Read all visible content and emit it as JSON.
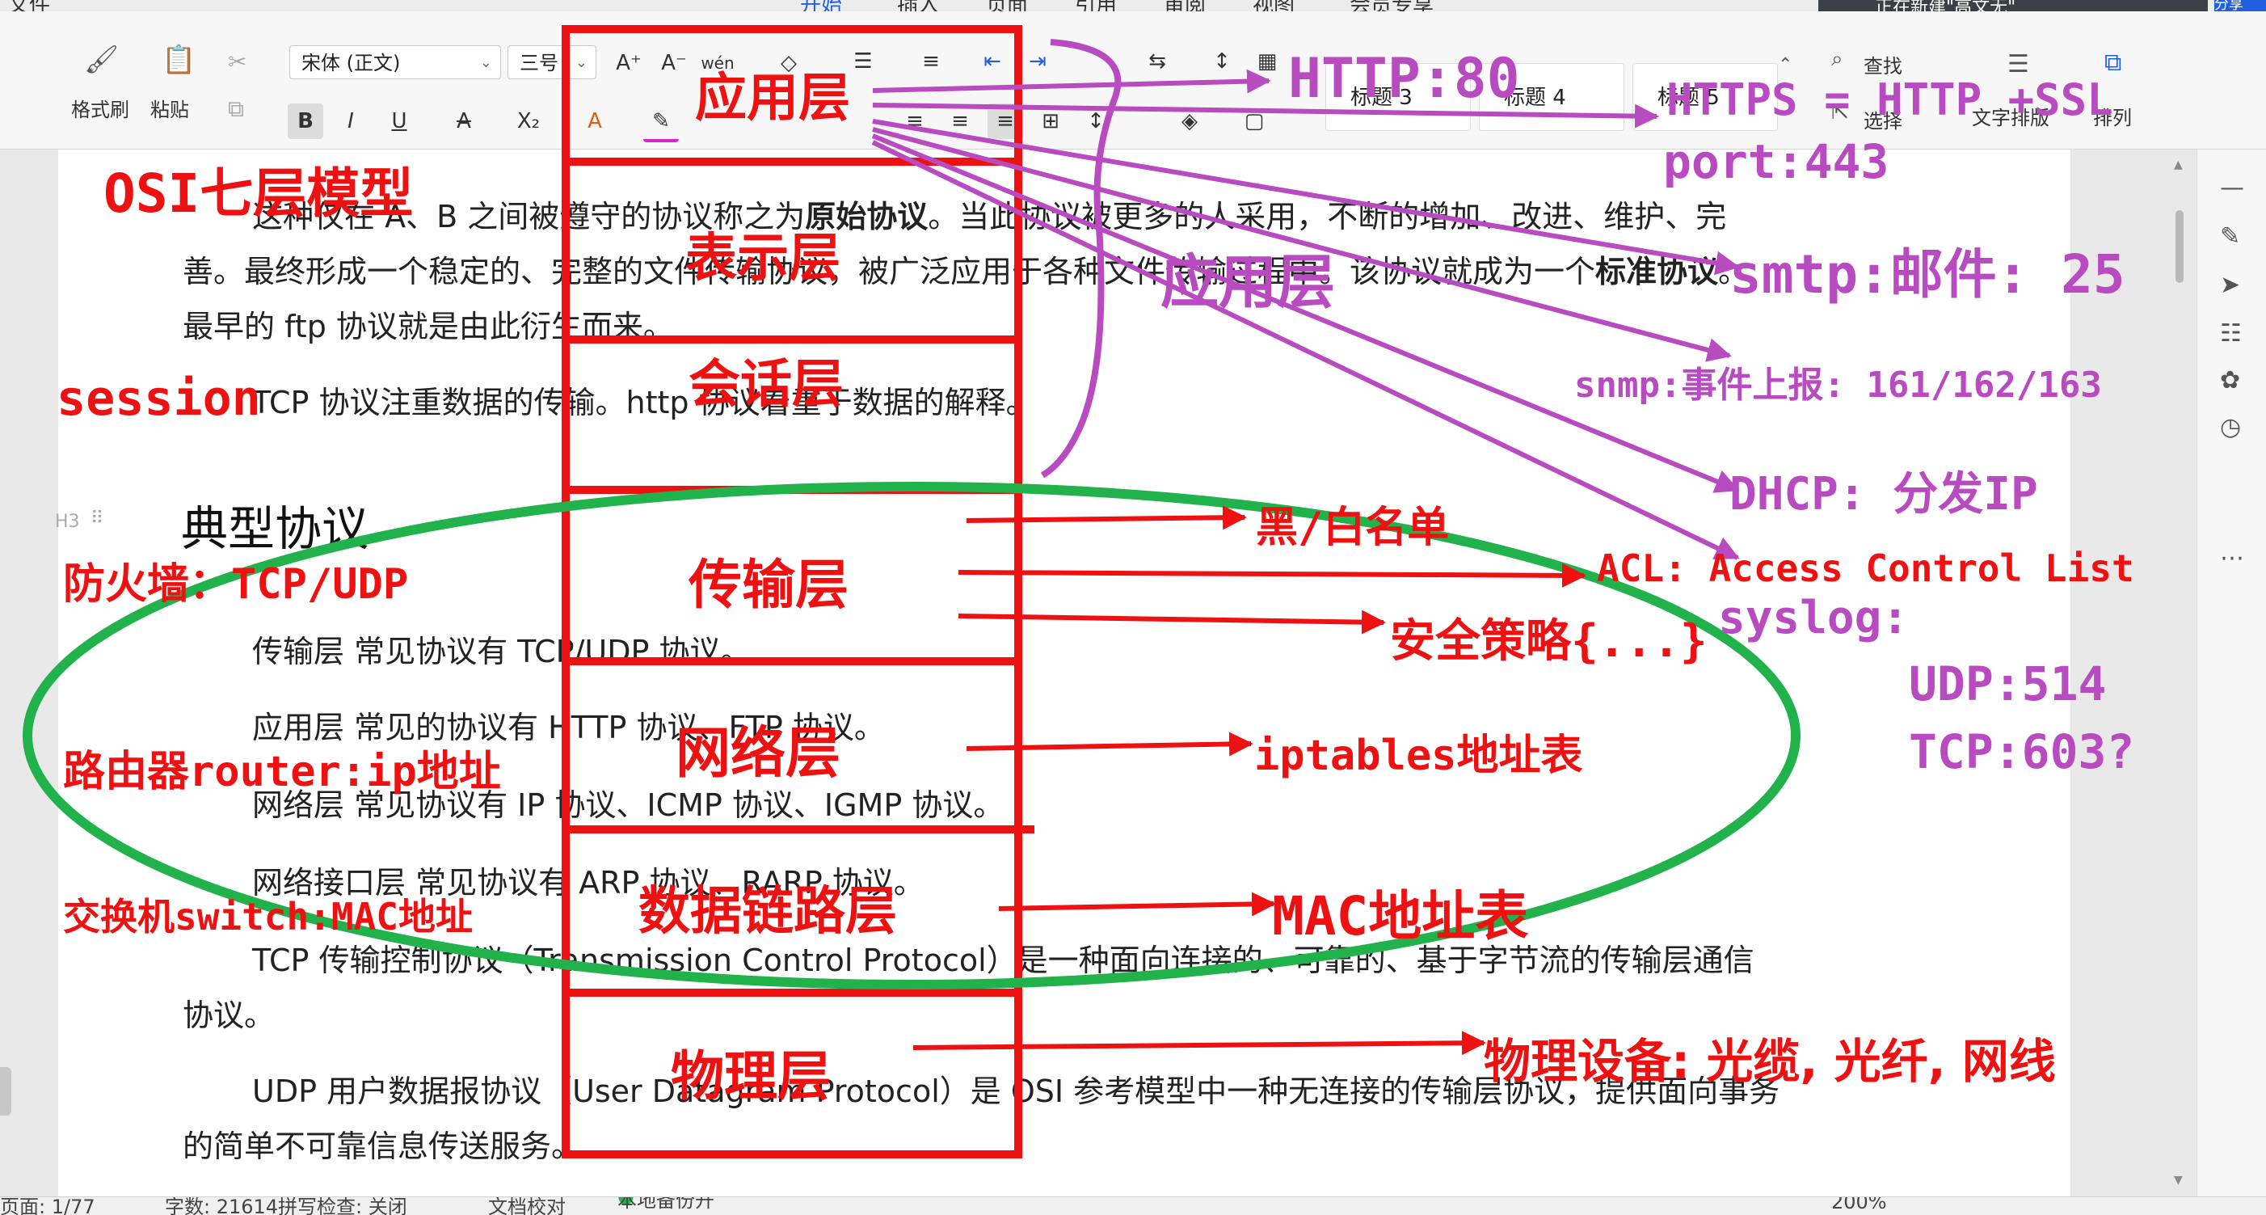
{
  "menu": {
    "items": [
      "文件",
      "开始",
      "插入",
      "页面",
      "引用",
      "审阅",
      "视图",
      "会员专享"
    ],
    "active_index": 1,
    "notification": "正在新建\"高文无\"",
    "share": "分享"
  },
  "ribbon": {
    "format_painter": "格式刷",
    "paste": "粘贴",
    "font_name": "宋体 (正文)",
    "font_size": "三号",
    "styles": [
      "标题 3",
      "标题 4",
      "标题 5"
    ],
    "find": "查找",
    "select": "选择",
    "layout": "文字排版",
    "arrange": "排列"
  },
  "doc": {
    "p1": "这种仅在 A、B 之间被遵守的协议称之为",
    "p1_bold": "原始协议",
    "p1_rest": "。当此协议被更多的人采用，不断的增加、改进、维护、完",
    "p2": "善。最终形成一个稳定的、完整的文件传输协议，被广泛应用于各种文件传输过程中。该协议就成为一个",
    "p2_bold": "标准协议",
    "p2_end": "。",
    "p3": "最早的 ftp 协议就是由此衍生而来。",
    "p4": "TCP 协议注重数据的传输。http 协议着重于数据的解释。",
    "heading": "典型协议",
    "heading_marker": "H3",
    "li1": "传输层  常见协议有 TCP/UDP 协议。",
    "li2": "应用层  常见的协议有 HTTP 协议、FTP 协议。",
    "li3": "网络层  常见协议有 IP 协议、ICMP 协议、IGMP 协议。",
    "li4": "网络接口层  常见协议有 ARP 协议、RARP 协议。",
    "tcp1": "TCP 传输控制协议（Transmission Control Protocol）是一种面向连接的、可靠的、基于字节流的传输层通信",
    "tcp2": "协议。",
    "udp1": "UDP 用户数据报协议（User Datagram Protocol）是 OSI 参考模型中一种无连接的传输层协议，提供面向事务",
    "udp2": "的简单不可靠信息传送服务。"
  },
  "annotations": {
    "osi_title": "OSI七层模型",
    "layers": [
      "应用层",
      "表示层",
      "会话层",
      "传输层",
      "网络层",
      "数据链路层",
      "物理层"
    ],
    "app_layer_side": "应用层",
    "session": "session",
    "firewall": "防火墙：TCP/UDP",
    "router": "路由器router:ip地址",
    "switch": "交换机switch:MAC地址",
    "http": "HTTP:80",
    "https": "HTTPS = HTTP +SSL",
    "https_port": "port:443",
    "smtp": "smtp:邮件: 25",
    "snmp": "snmp:事件上报: 161/162/163",
    "dhcp": "DHCP: 分发IP",
    "acl": "ACL: Access Control List",
    "syslog": "syslog:",
    "syslog_udp": "UDP:514",
    "syslog_tcp": "TCP:603?",
    "blacklist": "黑/白名单",
    "security": "安全策略{...}",
    "iptables": "iptables地址表",
    "mac_table": "MAC地址表",
    "physical": "物理设备: 光缆, 光纤, 网线"
  },
  "status": {
    "page": "页面: 1/77",
    "words": "字数: 21614",
    "spell": "拼写检查: 关闭",
    "proof": "文档校对",
    "backup": "本地备份开",
    "zoom": "200%"
  },
  "colors": {
    "red": "#ee1111",
    "purple": "#b84bc0",
    "green": "#22b24c",
    "accent": "#1f5fe0"
  }
}
